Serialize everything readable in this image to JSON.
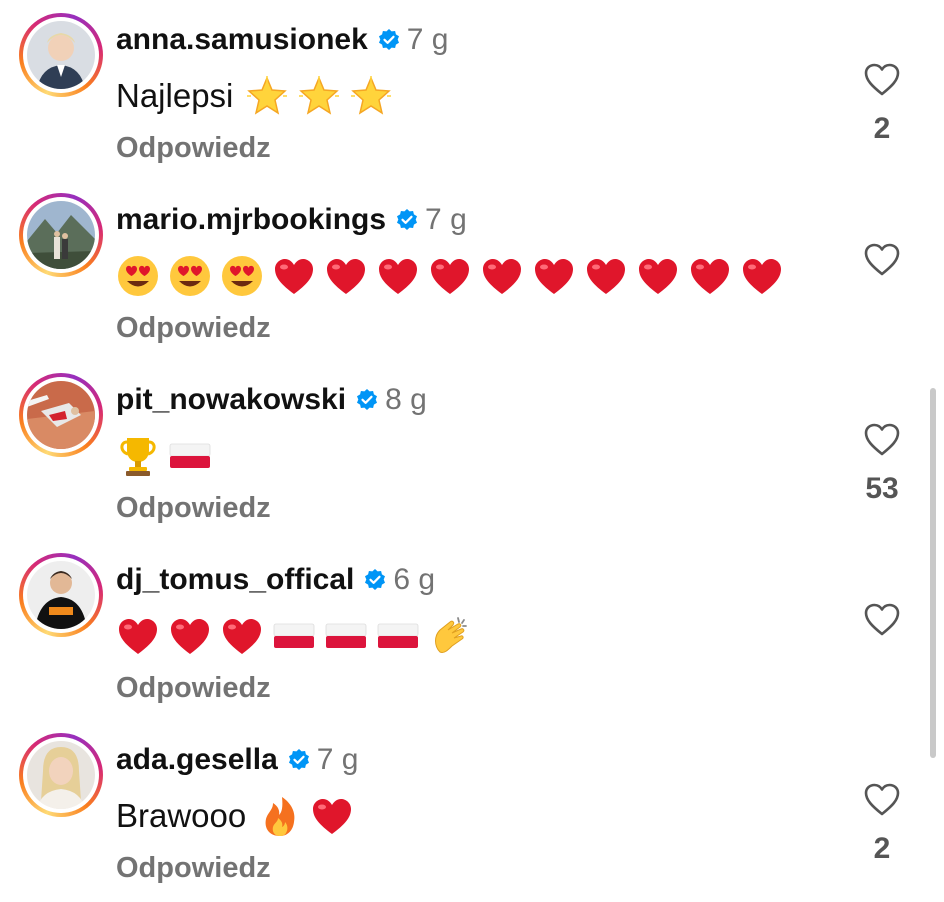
{
  "comments": [
    {
      "username": "anna.samusionek",
      "time": "7 g",
      "text": "Najlepsi",
      "emojis": [
        "star",
        "star",
        "star"
      ],
      "reply_label": "Odpowiedz",
      "likes": "2"
    },
    {
      "username": "mario.mjrbookings",
      "time": "7 g",
      "text": "",
      "emojis": [
        "heart-eyes",
        "heart-eyes",
        "heart-eyes",
        "heart",
        "heart",
        "heart",
        "heart",
        "heart",
        "heart",
        "heart",
        "heart",
        "heart",
        "heart"
      ],
      "reply_label": "Odpowiedz",
      "likes": ""
    },
    {
      "username": "pit_nowakowski",
      "time": "8 g",
      "text": "",
      "emojis": [
        "trophy",
        "poland-flag"
      ],
      "reply_label": "Odpowiedz",
      "likes": "53"
    },
    {
      "username": "dj_tomus_offical",
      "time": "6 g",
      "text": "",
      "emojis": [
        "heart",
        "heart",
        "heart",
        "poland-flag",
        "poland-flag",
        "poland-flag",
        "clap"
      ],
      "reply_label": "Odpowiedz",
      "likes": ""
    },
    {
      "username": "ada.gesella",
      "time": "7 g",
      "text": "Brawooo",
      "emojis": [
        "fire",
        "heart"
      ],
      "reply_label": "Odpowiedz",
      "likes": "2"
    }
  ],
  "colors": {
    "verified": "#0095f6",
    "secondary_text": "#737373",
    "heart_red": "#e0162b"
  },
  "icons": {
    "like": "heart-outline-icon",
    "verified": "verified-badge-icon"
  }
}
